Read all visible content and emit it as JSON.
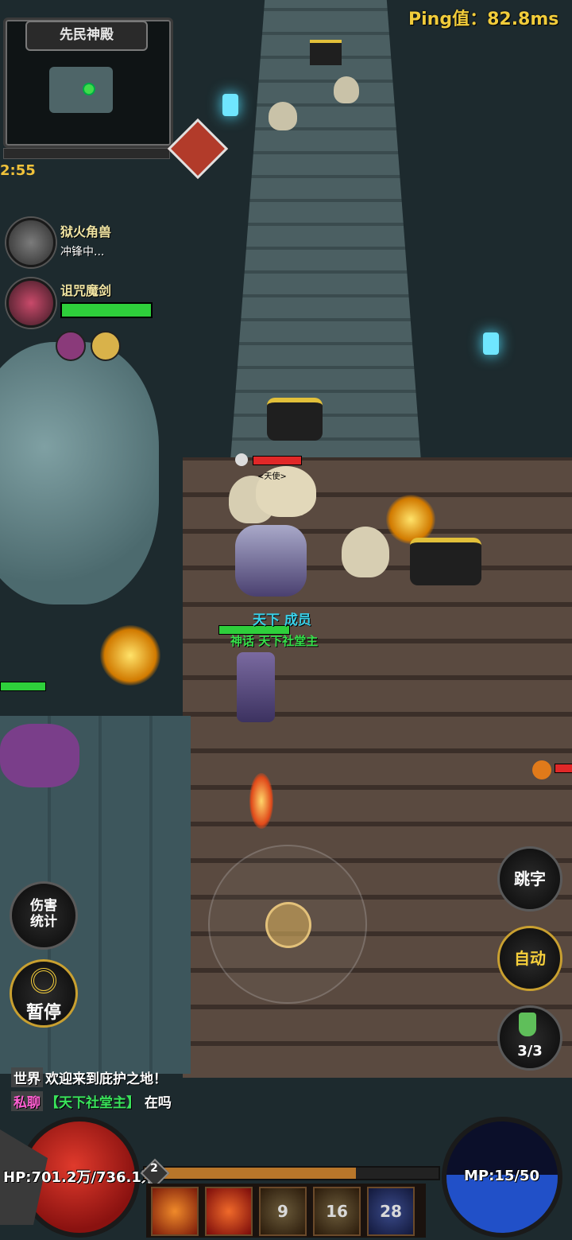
{
  "hud": {
    "ping": "Ping值：82.8ms",
    "map_name": "先民神殿",
    "timer": "2:55"
  },
  "bosses": [
    {
      "name": "狱火角兽",
      "status": "冲锋中..."
    },
    {
      "name": "诅咒魔剑",
      "hp_fraction": 1.0
    }
  ],
  "player": {
    "guild_role": "天下 成员",
    "title": "神话 天下社堂主"
  },
  "enemy_tag": "<天使>",
  "buttons": {
    "jump_text": "跳字",
    "auto": "自动",
    "damage_stats": "伤害统计",
    "pause": "暂停",
    "potion_count": "3/3"
  },
  "chat": [
    {
      "channel": "世界",
      "text": "欢迎来到庇护之地！"
    },
    {
      "channel": "私聊",
      "name": "【天下社堂主】",
      "text": "在吗"
    }
  ],
  "stats": {
    "hp": "HP:701.2万/736.1万",
    "mp": "MP:15/50",
    "level": "2",
    "xp_fraction": 0.72
  },
  "skills": [
    {
      "icon": "flame-slash-icon",
      "cooldown": ""
    },
    {
      "icon": "fire-vortex-icon",
      "cooldown": ""
    },
    {
      "icon": "spark-strike-icon",
      "cooldown": "9"
    },
    {
      "icon": "burst-icon",
      "cooldown": "16"
    },
    {
      "icon": "arcane-icon",
      "cooldown": "28"
    }
  ],
  "colors": {
    "ping": "#f1cc3b",
    "hp_green": "#2ecf3b",
    "guild_cyan": "#39d0e8",
    "title_green": "#36e04a",
    "private_pink": "#ff5fd2"
  }
}
